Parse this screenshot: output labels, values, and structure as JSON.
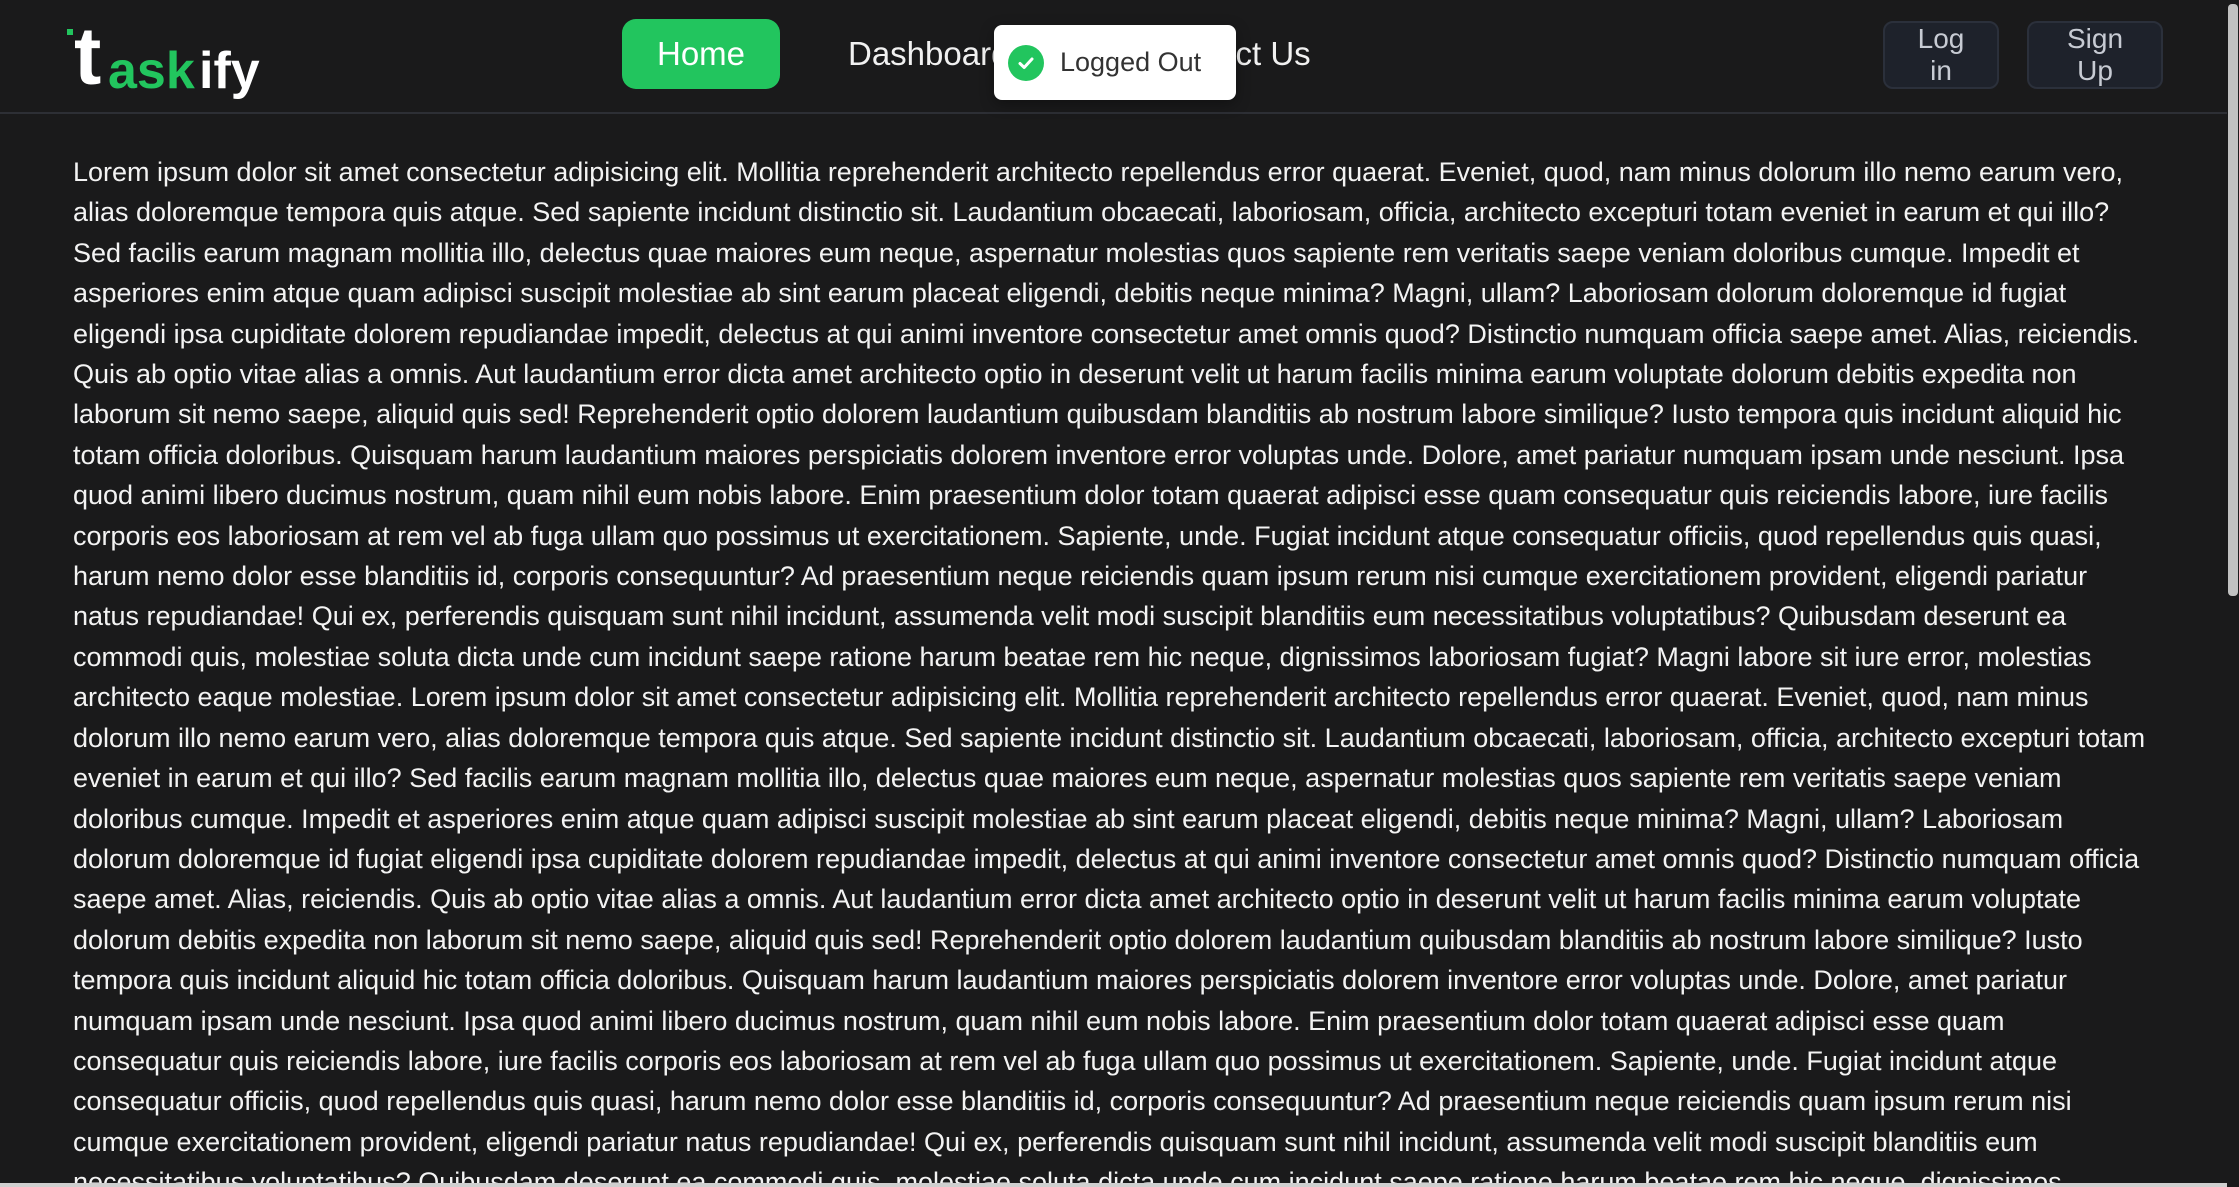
{
  "brand": {
    "logo_text_t": "t",
    "logo_text_ask": "ask",
    "logo_text_ify": "ify",
    "accent_color": "#22c55e"
  },
  "nav": {
    "items": [
      {
        "label": "Home",
        "active": true
      },
      {
        "label": "Dashboard",
        "active": false
      },
      {
        "label": "Contact Us",
        "active": false
      }
    ]
  },
  "auth": {
    "login_label": "Log in",
    "signup_label": "Sign Up"
  },
  "toast": {
    "message": "Logged Out",
    "icon": "check-circle-icon"
  },
  "content": {
    "paragraph": "Lorem ipsum dolor sit amet consectetur adipisicing elit. Mollitia reprehenderit architecto repellendus error quaerat. Eveniet, quod, nam minus dolorum illo nemo earum vero, alias doloremque tempora quis atque. Sed sapiente incidunt distinctio sit. Laudantium obcaecati, laboriosam, officia, architecto excepturi totam eveniet in earum et qui illo? Sed facilis earum magnam mollitia illo, delectus quae maiores eum neque, aspernatur molestias quos sapiente rem veritatis saepe veniam doloribus cumque. Impedit et asperiores enim atque quam adipisci suscipit molestiae ab sint earum placeat eligendi, debitis neque minima? Magni, ullam? Laboriosam dolorum doloremque id fugiat eligendi ipsa cupiditate dolorem repudiandae impedit, delectus at qui animi inventore consectetur amet omnis quod? Distinctio numquam officia saepe amet. Alias, reiciendis. Quis ab optio vitae alias a omnis. Aut laudantium error dicta amet architecto optio in deserunt velit ut harum facilis minima earum voluptate dolorum debitis expedita non laborum sit nemo saepe, aliquid quis sed! Reprehenderit optio dolorem laudantium quibusdam blanditiis ab nostrum labore similique? Iusto tempora quis incidunt aliquid hic totam officia doloribus. Quisquam harum laudantium maiores perspiciatis dolorem inventore error voluptas unde. Dolore, amet pariatur numquam ipsam unde nesciunt. Ipsa quod animi libero ducimus nostrum, quam nihil eum nobis labore. Enim praesentium dolor totam quaerat adipisci esse quam consequatur quis reiciendis labore, iure facilis corporis eos laboriosam at rem vel ab fuga ullam quo possimus ut exercitationem. Sapiente, unde. Fugiat incidunt atque consequatur officiis, quod repellendus quis quasi, harum nemo dolor esse blanditiis id, corporis consequuntur? Ad praesentium neque reiciendis quam ipsum rerum nisi cumque exercitationem provident, eligendi pariatur natus repudiandae! Qui ex, perferendis quisquam sunt nihil incidunt, assumenda velit modi suscipit blanditiis eum necessitatibus voluptatibus? Quibusdam deserunt ea commodi quis, molestiae soluta dicta unde cum incidunt saepe ratione harum beatae rem hic neque, dignissimos laboriosam fugiat? Magni labore sit iure error, molestias architecto eaque molestiae. Lorem ipsum dolor sit amet consectetur adipisicing elit. Mollitia reprehenderit architecto repellendus error quaerat. Eveniet, quod, nam minus dolorum illo nemo earum vero, alias doloremque tempora quis atque. Sed sapiente incidunt distinctio sit. Laudantium obcaecati, laboriosam, officia, architecto excepturi totam eveniet in earum et qui illo? Sed facilis earum magnam mollitia illo, delectus quae maiores eum neque, aspernatur molestias quos sapiente rem veritatis saepe veniam doloribus cumque. Impedit et asperiores enim atque quam adipisci suscipit molestiae ab sint earum placeat eligendi, debitis neque minima? Magni, ullam? Laboriosam dolorum doloremque id fugiat eligendi ipsa cupiditate dolorem repudiandae impedit, delectus at qui animi inventore consectetur amet omnis quod? Distinctio numquam officia saepe amet. Alias, reiciendis. Quis ab optio vitae alias a omnis. Aut laudantium error dicta amet architecto optio in deserunt velit ut harum facilis minima earum voluptate dolorum debitis expedita non laborum sit nemo saepe, aliquid quis sed! Reprehenderit optio dolorem laudantium quibusdam blanditiis ab nostrum labore similique? Iusto tempora quis incidunt aliquid hic totam officia doloribus. Quisquam harum laudantium maiores perspiciatis dolorem inventore error voluptas unde. Dolore, amet pariatur numquam ipsam unde nesciunt. Ipsa quod animi libero ducimus nostrum, quam nihil eum nobis labore. Enim praesentium dolor totam quaerat adipisci esse quam consequatur quis reiciendis labore, iure facilis corporis eos laboriosam at rem vel ab fuga ullam quo possimus ut exercitationem. Sapiente, unde. Fugiat incidunt atque consequatur officiis, quod repellendus quis quasi, harum nemo dolor esse blanditiis id, corporis consequuntur? Ad praesentium neque reiciendis quam ipsum rerum nisi cumque exercitationem provident, eligendi pariatur natus repudiandae! Qui ex, perferendis quisquam sunt nihil incidunt, assumenda velit modi suscipit blanditiis eum necessitatibus voluptatibus? Quibusdam deserunt ea commodi quis, molestiae soluta dicta unde cum incidunt saepe ratione harum beatae rem hic neque, dignissimos laboriosam fugiat? Magni labore sit"
  }
}
